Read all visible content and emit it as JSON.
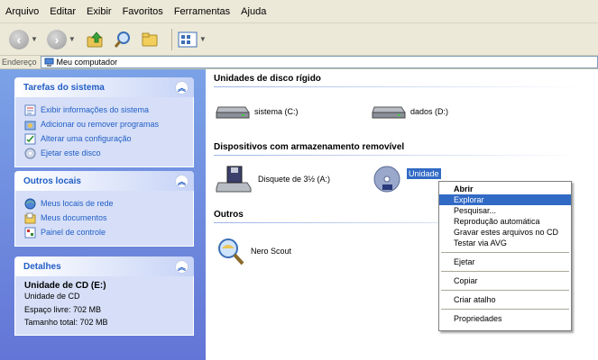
{
  "menu_bar": {
    "items": [
      "Arquivo",
      "Editar",
      "Exibir",
      "Favoritos",
      "Ferramentas",
      "Ajuda"
    ]
  },
  "address_bar": {
    "label": "Endereço",
    "value": "Meu computador",
    "icon": "my-computer-icon"
  },
  "task_pane": {
    "system_tasks": {
      "title": "Tarefas do sistema",
      "items": [
        {
          "label": "Exibir informações do sistema",
          "icon": "system-info-icon"
        },
        {
          "label": "Adicionar ou remover programas",
          "icon": "add-remove-programs-icon"
        },
        {
          "label": "Alterar uma configuração",
          "icon": "control-setting-icon"
        },
        {
          "label": "Ejetar este disco",
          "icon": "eject-disc-icon"
        }
      ]
    },
    "other_places": {
      "title": "Outros locais",
      "items": [
        {
          "label": "Meus locais de rede",
          "icon": "network-places-icon"
        },
        {
          "label": "Meus documentos",
          "icon": "my-documents-icon"
        },
        {
          "label": "Painel de controle",
          "icon": "control-panel-icon"
        }
      ]
    },
    "details": {
      "title": "Detalhes",
      "name": "Unidade de CD (E:)",
      "type": "Unidade de CD",
      "free_space": "Espaço livre: 702 MB",
      "total_size": "Tamanho total: 702 MB"
    }
  },
  "content": {
    "hard_drives": {
      "heading": "Unidades de disco rígido",
      "items": [
        {
          "label": "sistema (C:)",
          "icon": "hard-drive-icon"
        },
        {
          "label": "dados (D:)",
          "icon": "hard-drive-icon"
        }
      ]
    },
    "removable": {
      "heading": "Dispositivos com armazenamento removível",
      "items": [
        {
          "label": "Disquete de 3½ (A:)",
          "icon": "floppy-drive-icon"
        },
        {
          "label": "Unidade",
          "icon": "cd-drive-icon"
        }
      ]
    },
    "others": {
      "heading": "Outros",
      "items": [
        {
          "label": "Nero Scout",
          "icon": "nero-scout-icon"
        }
      ]
    }
  },
  "context_menu": {
    "items": [
      {
        "label": "Abrir"
      },
      {
        "label": "Explorar"
      },
      {
        "label": "Pesquisar..."
      },
      {
        "label": "Reprodução automática"
      },
      {
        "label": "Gravar estes arquivos no CD"
      },
      {
        "label": "Testar via AVG"
      },
      {
        "label": "Ejetar"
      },
      {
        "label": "Copiar"
      },
      {
        "label": "Criar atalho"
      },
      {
        "label": "Propriedades"
      }
    ]
  },
  "colors": {
    "task_pane_top": "#7ba2e7",
    "task_pane_bottom": "#6375d6",
    "link_blue": "#215dc6",
    "selection_blue": "#316ac5",
    "chrome_beige": "#ece9d8"
  }
}
